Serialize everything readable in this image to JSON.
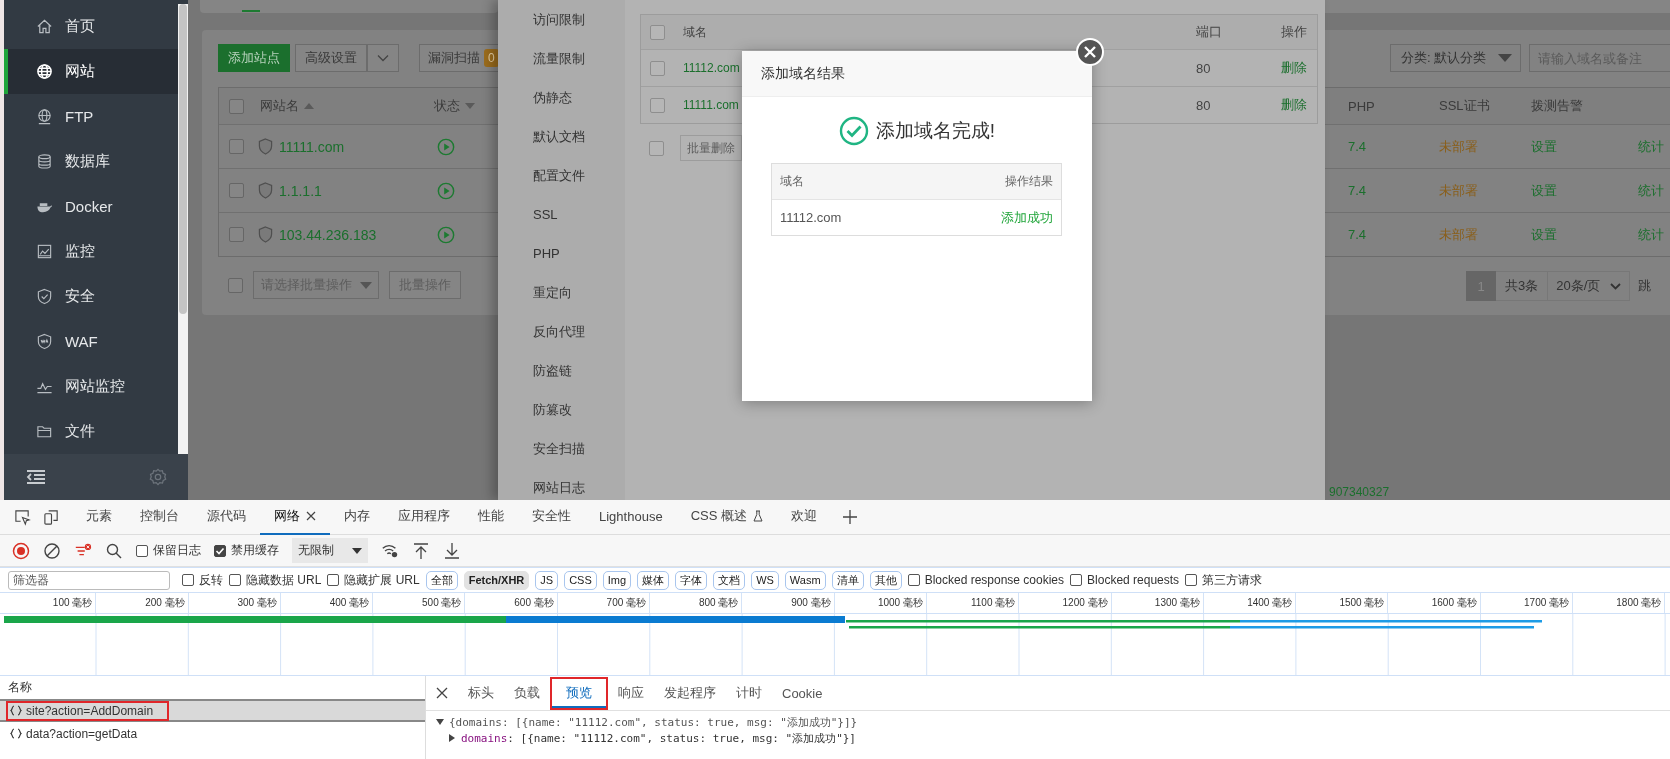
{
  "sidebar": {
    "items": [
      {
        "label": "首页",
        "selected": false
      },
      {
        "label": "网站",
        "selected": true
      },
      {
        "label": "FTP",
        "selected": false
      },
      {
        "label": "数据库",
        "selected": false
      },
      {
        "label": "Docker",
        "selected": false
      },
      {
        "label": "监控",
        "selected": false
      },
      {
        "label": "安全",
        "selected": false
      },
      {
        "label": "WAF",
        "selected": false
      },
      {
        "label": "网站监控",
        "selected": false
      },
      {
        "label": "文件",
        "selected": false
      }
    ]
  },
  "toolbar": {
    "buttons": [
      {
        "kind": "primary",
        "label": "添加站点"
      },
      {
        "kind": "dropdown",
        "label": "高级设置"
      },
      {
        "kind": "badge",
        "label": "漏洞扫描",
        "badge": "0"
      }
    ],
    "category": "分类: 默认分类",
    "search": {
      "placeholder": "请输入域名或备注"
    }
  },
  "sites_table": {
    "columns": [
      "网站名",
      "状态",
      "PHP",
      "SSL证书",
      "拨测告警"
    ],
    "header_checked": false,
    "rows": [
      {
        "checked": false,
        "name": "11111.com",
        "php": "7.4",
        "ssl": "未部署",
        "alert": "设置",
        "stats": "统计"
      },
      {
        "checked": false,
        "name": "1.1.1.1",
        "php": "7.4",
        "ssl": "未部署",
        "alert": "设置",
        "stats": "统计"
      },
      {
        "checked": false,
        "name": "103.44.236.183",
        "php": "7.4",
        "ssl": "未部署",
        "alert": "设置",
        "stats": "统计"
      }
    ]
  },
  "batch": {
    "checked": false,
    "placeholder": "请选择批量操作",
    "button": "批量操作"
  },
  "pagination": {
    "current": "1",
    "total": "共3条",
    "page_size": "20条/页",
    "jump": "跳"
  },
  "footer": {
    "text": "907340327"
  },
  "drawer": {
    "menu": [
      "访问限制",
      "流量限制",
      "伪静态",
      "默认文档",
      "配置文件",
      "SSL",
      "PHP",
      "重定向",
      "反向代理",
      "防盗链",
      "防篡改",
      "安全扫描",
      "网站日志"
    ],
    "domains": {
      "columns": [
        "域名",
        "端口",
        "操作"
      ],
      "header_checked": false,
      "rows": [
        {
          "checked": false,
          "domain": "11112.com",
          "port": "80",
          "action": "删除"
        },
        {
          "checked": false,
          "domain": "11111.com",
          "port": "80",
          "action": "删除"
        }
      ]
    },
    "batch_checked": false,
    "batch_delete": "批量删除"
  },
  "modal": {
    "title": "添加域名结果",
    "message": "添加域名完成!",
    "columns": [
      "域名",
      "操作结果"
    ],
    "rows": [
      {
        "domain": "11112.com",
        "result": "添加成功"
      }
    ]
  },
  "devtools": {
    "tabs": [
      {
        "label": "元素",
        "selected": false
      },
      {
        "label": "控制台",
        "selected": false
      },
      {
        "label": "源代码",
        "selected": false
      },
      {
        "label": "网络",
        "selected": true,
        "closable": true
      },
      {
        "label": "内存",
        "selected": false
      },
      {
        "label": "应用程序",
        "selected": false
      },
      {
        "label": "性能",
        "selected": false
      },
      {
        "label": "安全性",
        "selected": false
      },
      {
        "label": "Lighthouse",
        "selected": false
      },
      {
        "label": "CSS 概述",
        "selected": false
      },
      {
        "label": "欢迎",
        "selected": false
      }
    ],
    "toolbar": {
      "checkboxes": [
        {
          "label": "保留日志",
          "checked": false
        },
        {
          "label": "禁用缓存",
          "checked": true
        }
      ],
      "throttle": "无限制"
    },
    "filter": {
      "placeholder": "筛选器",
      "checkboxes": [
        {
          "label": "反转",
          "checked": false
        },
        {
          "label": "隐藏数据 URL",
          "checked": false
        },
        {
          "label": "隐藏扩展 URL",
          "checked": false
        }
      ],
      "types": [
        {
          "label": "全部",
          "selected": false
        },
        {
          "label": "Fetch/XHR",
          "selected": true
        },
        {
          "label": "JS",
          "selected": false
        },
        {
          "label": "CSS",
          "selected": false
        },
        {
          "label": "Img",
          "selected": false
        },
        {
          "label": "媒体",
          "selected": false
        },
        {
          "label": "字体",
          "selected": false
        },
        {
          "label": "文档",
          "selected": false
        },
        {
          "label": "WS",
          "selected": false
        },
        {
          "label": "Wasm",
          "selected": false
        },
        {
          "label": "清单",
          "selected": false
        },
        {
          "label": "其他",
          "selected": false
        }
      ],
      "extra_checkboxes": [
        {
          "label": "Blocked response cookies",
          "checked": false
        },
        {
          "label": "Blocked requests",
          "checked": false
        },
        {
          "label": "第三方请求",
          "checked": false
        }
      ]
    },
    "timeline": {
      "ticks": [
        "100 毫秒",
        "200 毫秒",
        "300 毫秒",
        "400 毫秒",
        "500 毫秒",
        "600 毫秒",
        "700 毫秒",
        "800 毫秒",
        "900 毫秒",
        "1000 毫秒",
        "1100 毫秒",
        "1200 毫秒",
        "1300 毫秒",
        "1400 毫秒",
        "1500 毫秒",
        "1600 毫秒",
        "1700 毫秒",
        "1800 毫秒"
      ]
    },
    "requests": {
      "header": "名称",
      "rows": [
        {
          "name": "site?action=AddDomain",
          "selected": true,
          "highlighted": true
        },
        {
          "name": "data?action=getData",
          "selected": false,
          "highlighted": false
        }
      ]
    },
    "details": {
      "tabs": [
        {
          "label": "标头",
          "selected": false,
          "highlighted": false
        },
        {
          "label": "负载",
          "selected": false,
          "highlighted": false
        },
        {
          "label": "预览",
          "selected": true,
          "highlighted": true
        },
        {
          "label": "响应",
          "selected": false,
          "highlighted": false
        },
        {
          "label": "发起程序",
          "selected": false,
          "highlighted": false
        },
        {
          "label": "计时",
          "selected": false,
          "highlighted": false
        },
        {
          "label": "Cookie",
          "selected": false,
          "highlighted": false
        }
      ],
      "preview": [
        {
          "expanded": true,
          "text": "{domains: [{name: \"11112.com\", status: true, msg: \"添加成功\"}]}"
        },
        {
          "expanded": false,
          "key": "domains",
          "text": ": [{name: \"11112.com\", status: true, msg: \"添加成功\"}]"
        }
      ]
    }
  }
}
